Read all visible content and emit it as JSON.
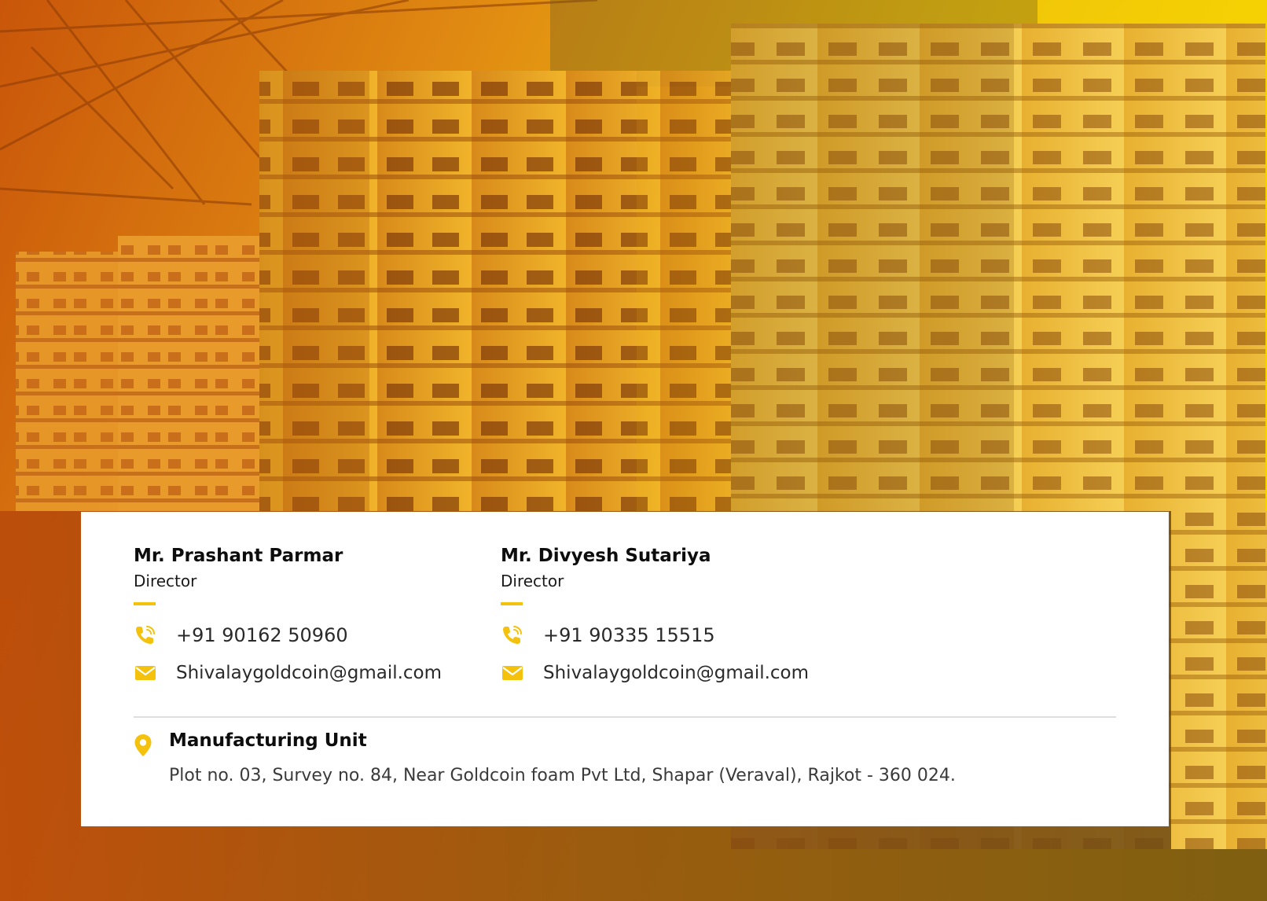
{
  "colors": {
    "accent": "#f4c20d",
    "card_bg": "#ffffff",
    "divider": "#dedede"
  },
  "hero": {
    "icon": "warehouse-pallets-image"
  },
  "contacts": [
    {
      "name": "Mr. Prashant Parmar",
      "role": "Director",
      "phone": "+91 90162 50960",
      "email": "Shivalaygoldcoin@gmail.com",
      "phone_icon": "phone-icon",
      "email_icon": "email-icon"
    },
    {
      "name": "Mr. Divyesh Sutariya",
      "role": "Director",
      "phone": "+91 90335 15515",
      "email": "Shivalaygoldcoin@gmail.com",
      "phone_icon": "phone-icon",
      "email_icon": "email-icon"
    }
  ],
  "manufacturing": {
    "title": "Manufacturing Unit",
    "address": "Plot no. 03, Survey no. 84, Near Goldcoin foam Pvt Ltd, Shapar (Veraval), Rajkot - 360 024.",
    "icon": "location-pin-icon"
  }
}
